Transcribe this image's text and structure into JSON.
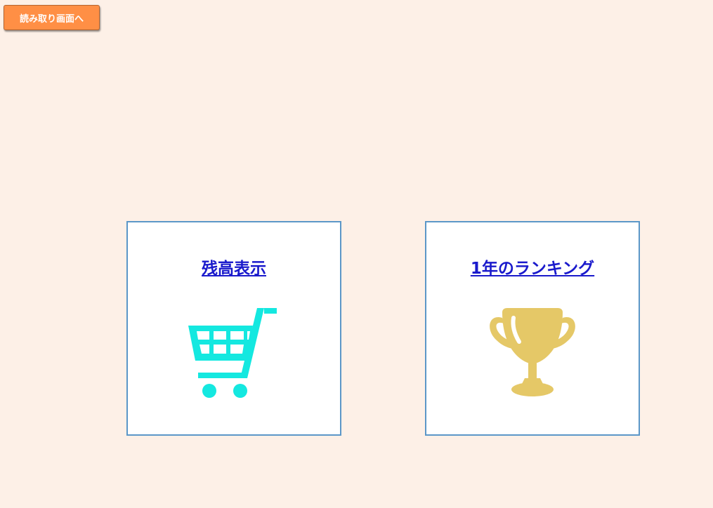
{
  "header": {
    "back_button_label": "読み取り画面へ"
  },
  "cards": [
    {
      "link_label": "残高表示",
      "icon": "shopping-cart-icon",
      "icon_color": "#14e8e0"
    },
    {
      "link_label": "1年のランキング",
      "icon": "trophy-icon",
      "icon_color": "#e5c867"
    }
  ],
  "colors": {
    "background": "#fdf0e7",
    "button": "#ff8f45",
    "card_border": "#5b97c8",
    "link": "#1a1acc"
  }
}
